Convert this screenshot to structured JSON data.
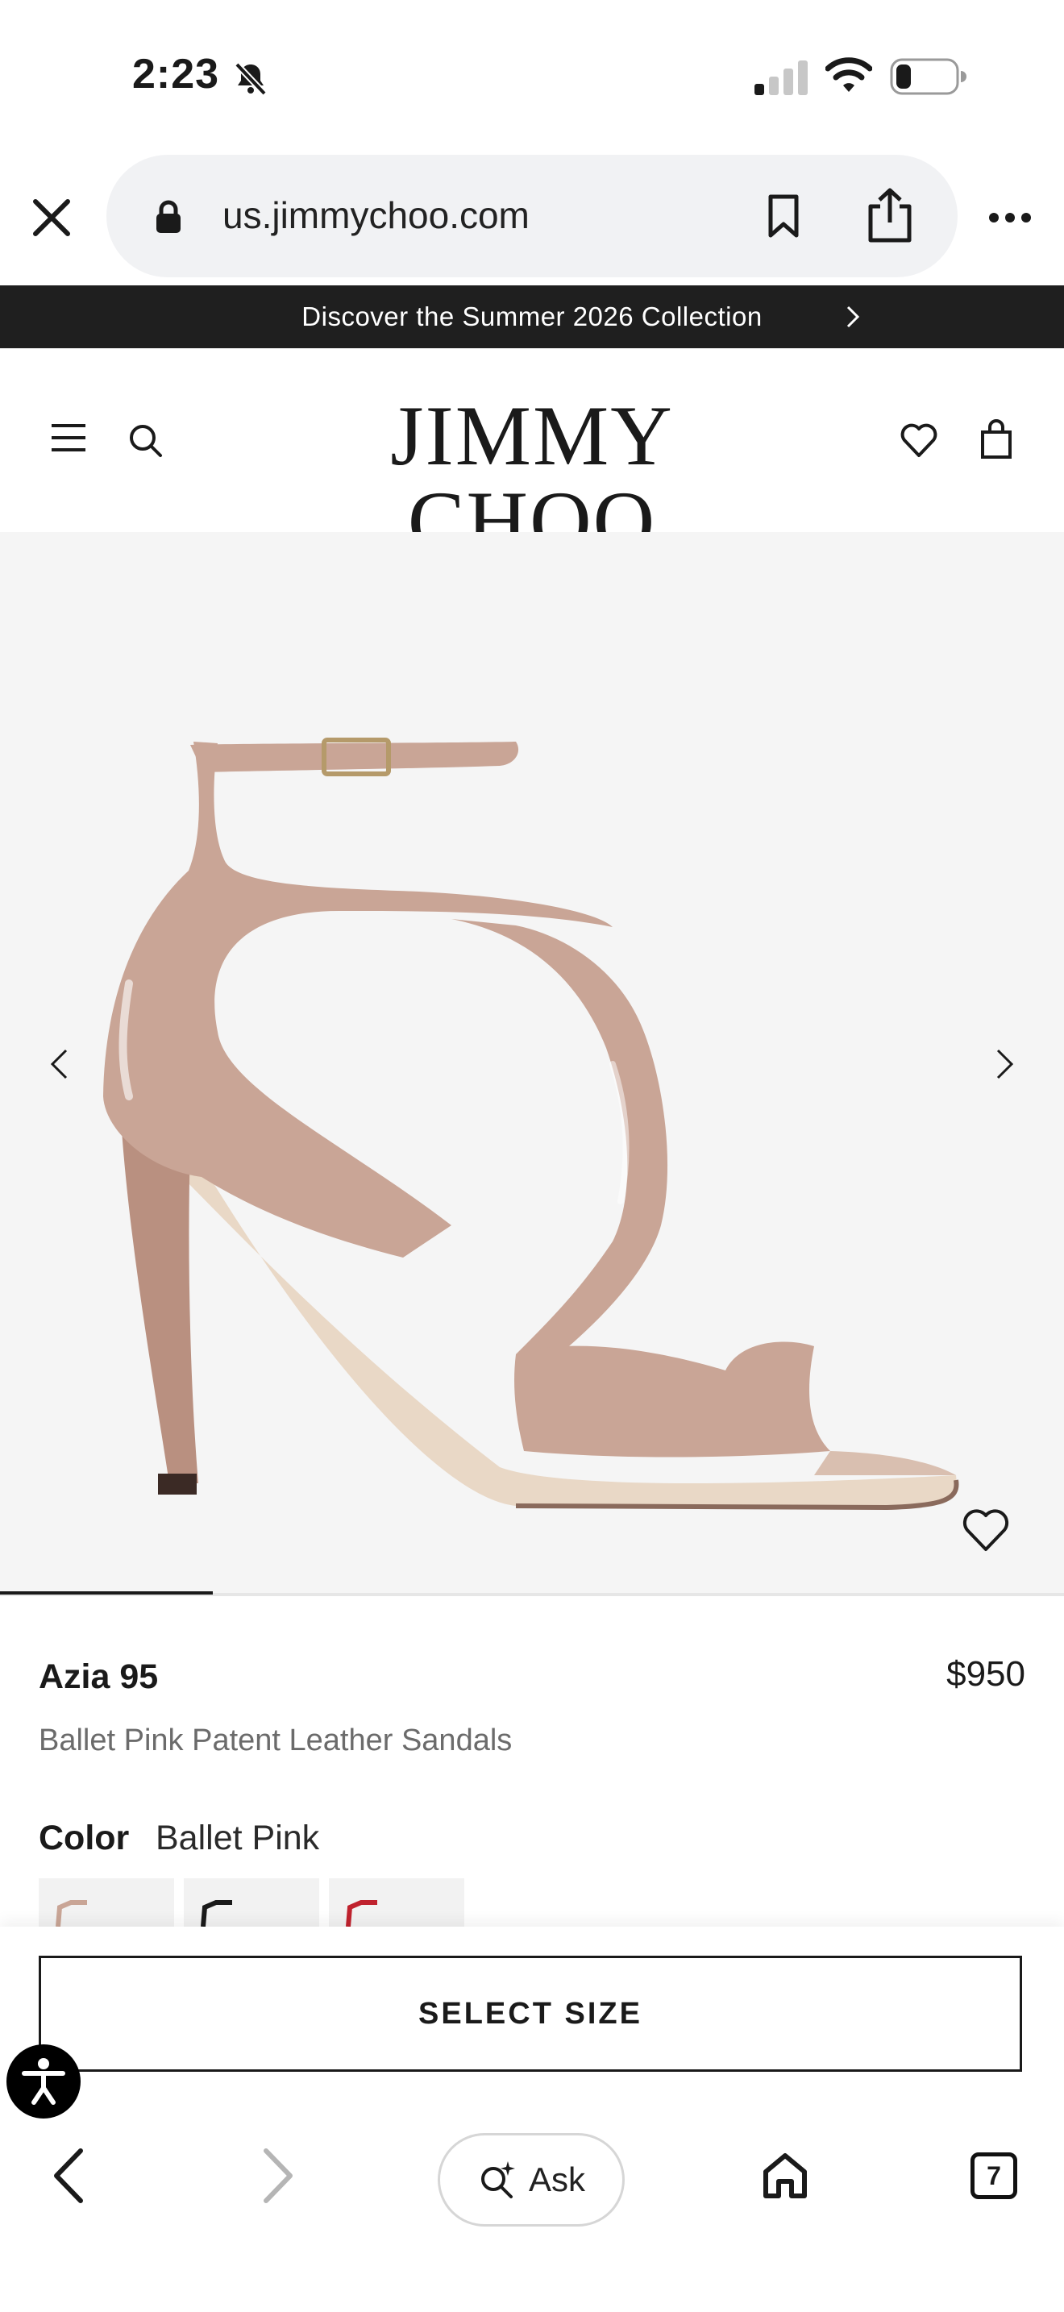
{
  "status_bar": {
    "time": "2:23",
    "battery_level": 0.2
  },
  "browser": {
    "url": "us.jimmychoo.com",
    "tabs_count": "7",
    "ask_label": "Ask"
  },
  "promo": {
    "text": "Discover the Summer 2026 Collection"
  },
  "header": {
    "logo": "JIMMY CHOO"
  },
  "gallery": {
    "progress": 0.2
  },
  "product": {
    "name": "Azia 95",
    "price": "$950",
    "description": "Ballet Pink Patent Leather Sandals",
    "color_label": "Color",
    "color_value": "Ballet Pink",
    "swatches": [
      "ballet-pink",
      "black",
      "red"
    ]
  },
  "cta": {
    "select_size": "SELECT SIZE"
  },
  "colors": {
    "banner": "#1f1f1f",
    "gallery_bg": "#f5f5f5",
    "shoe": "#c9a596",
    "sole": "#e9d8c6"
  }
}
